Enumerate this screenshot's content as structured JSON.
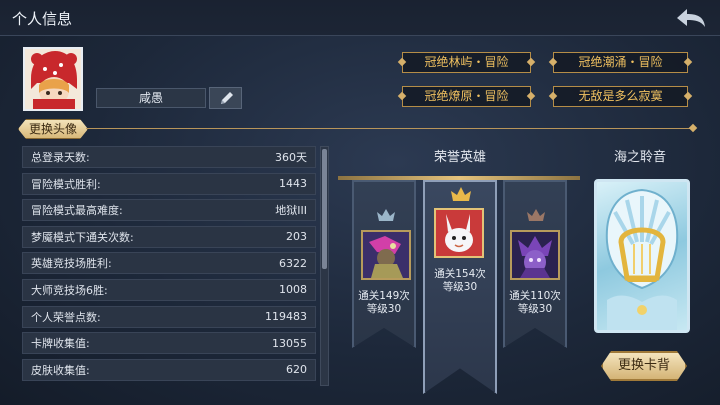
{
  "header": {
    "title": "个人信息"
  },
  "profile": {
    "name": "咸愚",
    "change_avatar_label": "更换头像"
  },
  "titles": [
    "冠绝林屿・冒险",
    "冠绝潮涌・冒险",
    "冠绝燎原・冒险",
    "无敌是多么寂寞"
  ],
  "stats": [
    {
      "label": "总登录天数:",
      "value": "360天"
    },
    {
      "label": "冒险模式胜利:",
      "value": "1443"
    },
    {
      "label": "冒险模式最高难度:",
      "value": "地狱III"
    },
    {
      "label": "梦魇模式下通关次数:",
      "value": "203"
    },
    {
      "label": "英雄竞技场胜利:",
      "value": "6322"
    },
    {
      "label": "大师竞技场6胜:",
      "value": "1008"
    },
    {
      "label": "个人荣誉点数:",
      "value": "119483"
    },
    {
      "label": "卡牌收集值:",
      "value": "13055"
    },
    {
      "label": "皮肤收集值:",
      "value": "620"
    }
  ],
  "honor_heroes": {
    "label": "荣誉英雄",
    "heroes": [
      {
        "clears": "通关149次",
        "level": "等级30",
        "rank": "silver"
      },
      {
        "clears": "通关154次",
        "level": "等级30",
        "rank": "gold"
      },
      {
        "clears": "通关110次",
        "level": "等级30",
        "rank": "bronze"
      }
    ]
  },
  "card_back": {
    "name": "海之聆音",
    "change_label": "更换卡背"
  },
  "colors": {
    "gold": "#f0c160",
    "panel": "#2a3444",
    "accent_line": "#b8955a"
  },
  "icons": {
    "back": "back-arrow-icon",
    "edit": "pencil-icon"
  }
}
